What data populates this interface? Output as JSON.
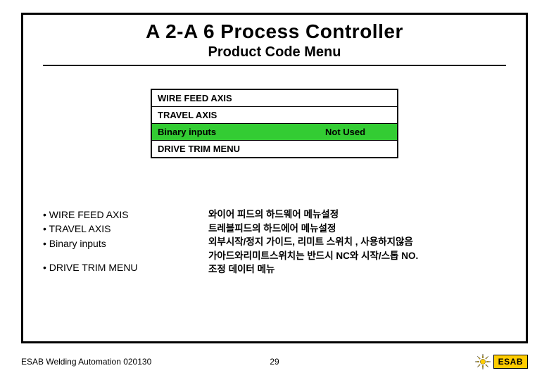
{
  "header": {
    "title": "A 2-A 6 Process Controller",
    "subtitle": "Product Code Menu"
  },
  "menu": {
    "rows": [
      {
        "label": "WIRE FEED AXIS",
        "value": "",
        "selected": false
      },
      {
        "label": "TRAVEL AXIS",
        "value": "",
        "selected": false
      },
      {
        "label": "Binary inputs",
        "value": "Not Used",
        "selected": true
      },
      {
        "label": "DRIVE TRIM MENU",
        "value": "",
        "selected": false
      }
    ]
  },
  "desc": {
    "left": [
      "• WIRE FEED AXIS",
      "• TRAVEL AXIS",
      "• Binary inputs",
      "",
      "• DRIVE TRIM MENU"
    ],
    "right": [
      "와이어 피드의 하드웨어 메뉴설정",
      "트레블피드의 하드에어 메뉴설정",
      "외부시작/정지 가이드, 리미트 스위치 , 사용하지않음",
      "가아드와리미트스위치는 반드시 NC와 시작/스톱 NO.",
      "조정 데이터 메뉴"
    ]
  },
  "footer": {
    "left": "ESAB Welding Automation 020130",
    "page": "29",
    "brand": "ESAB"
  }
}
